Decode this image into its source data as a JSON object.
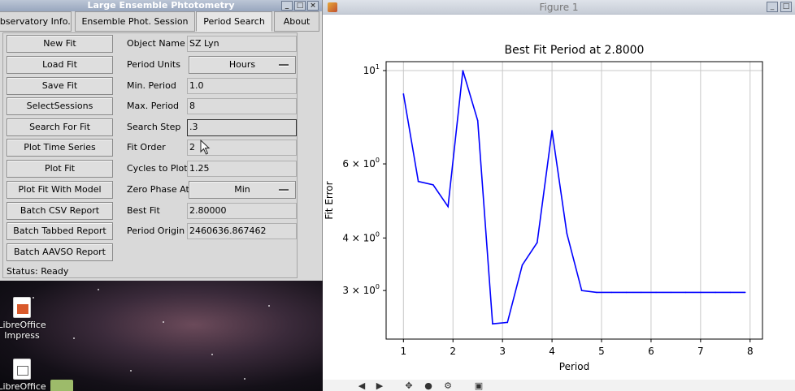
{
  "app": {
    "title": "Large Ensemble Phtotometry",
    "tabs": [
      "Observatory Info.",
      "Ensemble Phot. Session",
      "Period Search",
      "About"
    ],
    "buttons": [
      "New Fit",
      "Load Fit",
      "Save Fit",
      "SelectSessions",
      "Search For Fit",
      "Plot Time Series",
      "Plot Fit",
      "Plot Fit With Model",
      "Batch CSV Report",
      "Batch Tabbed Report",
      "Batch AAVSO Report"
    ],
    "fields": {
      "object_name": {
        "label": "Object Name",
        "value": "SZ Lyn"
      },
      "period_units": {
        "label": "Period Units",
        "value": "Hours"
      },
      "min_period": {
        "label": "Min. Period",
        "value": "1.0"
      },
      "max_period": {
        "label": "Max. Period",
        "value": "8"
      },
      "search_step": {
        "label": "Search Step",
        "value": ".3"
      },
      "fit_order": {
        "label": "Fit Order",
        "value": "2"
      },
      "cycles_to_plot": {
        "label": "Cycles to Plot",
        "value": "1.25"
      },
      "zero_phase_at": {
        "label": "Zero Phase At",
        "value": "Min"
      },
      "best_fit": {
        "label": "Best Fit",
        "value": "2.80000"
      },
      "period_origin": {
        "label": "Period Origin",
        "value": "2460636.867462"
      }
    },
    "status": "Status: Ready"
  },
  "desktop": {
    "icons": [
      "LibreOffice Impress",
      "LibreOffice"
    ]
  },
  "figure": {
    "window_title": "Figure 1"
  },
  "chart_data": {
    "type": "line",
    "title": "Best Fit Period at 2.8000",
    "xlabel": "Period",
    "ylabel": "Fit Error",
    "xlim": [
      0.65,
      8.25
    ],
    "ylim": [
      2.3,
      10.5
    ],
    "yscale": "log",
    "grid": "vertical",
    "x_ticks": [
      "1",
      "2",
      "3",
      "4",
      "5",
      "6",
      "7",
      "8"
    ],
    "y_ticks": [
      "10^1",
      "6 × 10^0",
      "4 × 10^0",
      "3 × 10^0"
    ],
    "series": [
      {
        "color": "#0000ff",
        "x": [
          1.0,
          1.3,
          1.6,
          1.9,
          2.2,
          2.5,
          2.8,
          3.1,
          3.4,
          3.7,
          4.0,
          4.3,
          4.6,
          4.9,
          5.2,
          5.5,
          5.8,
          6.1,
          6.4,
          6.7,
          7.0,
          7.3,
          7.6,
          7.9
        ],
        "y": [
          8.8,
          5.45,
          5.35,
          4.75,
          10.0,
          7.6,
          2.5,
          2.52,
          3.45,
          3.9,
          7.2,
          4.1,
          3.0,
          2.97,
          2.97,
          2.97,
          2.97,
          2.97,
          2.97,
          2.97,
          2.97,
          2.97,
          2.97,
          2.97
        ]
      }
    ]
  }
}
